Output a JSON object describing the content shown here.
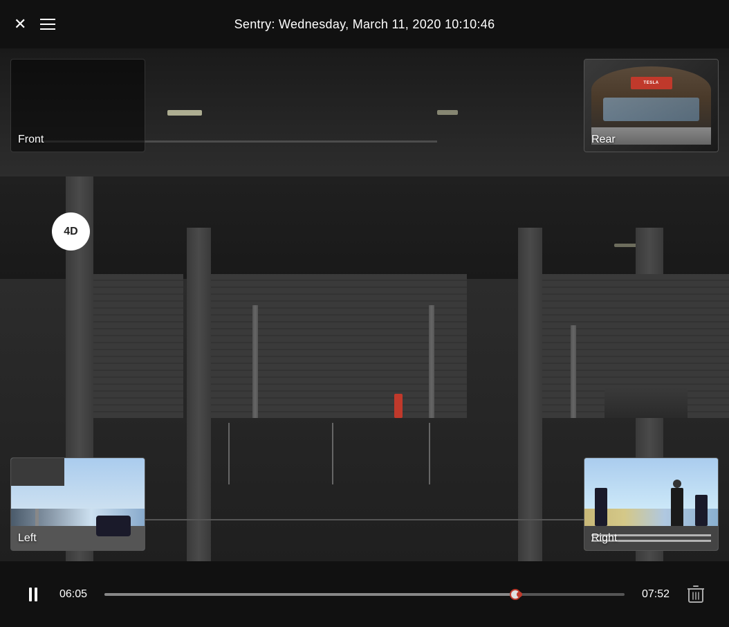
{
  "header": {
    "title": "Sentry: Wednesday, March 11, 2020 10:10:46",
    "close_label": "×",
    "menu_label": "menu"
  },
  "cameras": {
    "front": {
      "label": "Front",
      "is_main": true
    },
    "rear": {
      "label": "Rear",
      "position": "top-right"
    },
    "left": {
      "label": "Left",
      "position": "bottom-left"
    },
    "right": {
      "label": "Right",
      "position": "bottom-right"
    }
  },
  "controls": {
    "time_current": "06:05",
    "time_total": "07:52",
    "progress_percent": 79,
    "play_state": "paused",
    "play_button_label": "pause",
    "delete_label": "delete"
  }
}
